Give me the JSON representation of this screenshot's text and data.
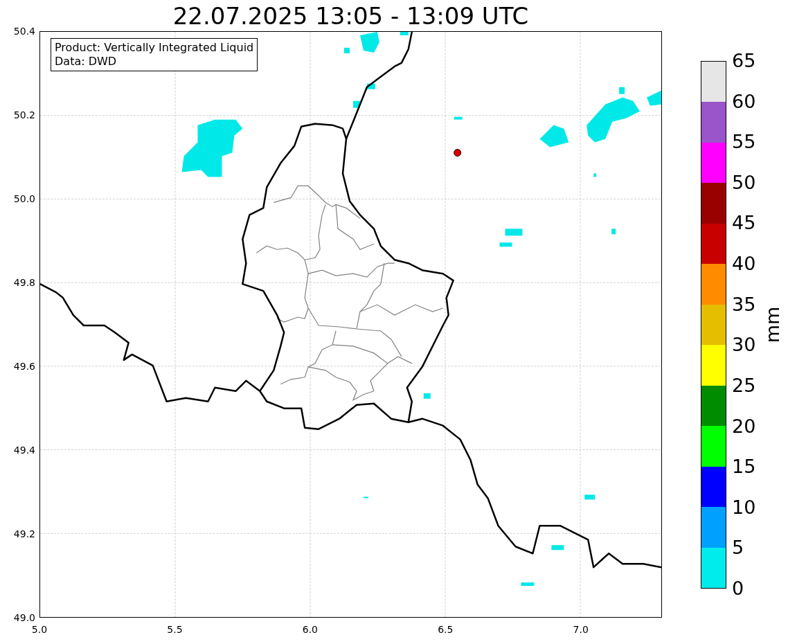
{
  "title": "22.07.2025 13:05 - 13:09 UTC",
  "legend": [
    "Product: Vertically Integrated Liquid",
    "Data: DWD"
  ],
  "y_ticks": [
    "50.4",
    "50.2",
    "50.0",
    "49.8",
    "49.6",
    "49.4",
    "49.2",
    "49.0"
  ],
  "x_ticks": [
    "5.0",
    "5.5",
    "6.0",
    "6.5",
    "7.0"
  ],
  "colorbar": {
    "label": "mm",
    "ticks": [
      "65",
      "60",
      "55",
      "50",
      "45",
      "40",
      "35",
      "30",
      "25",
      "20",
      "15",
      "10",
      "5",
      "0"
    ],
    "segments": [
      {
        "color": "#e6e6e6"
      },
      {
        "color": "#9955c9"
      },
      {
        "color": "#ff00ff"
      },
      {
        "color": "#990000"
      },
      {
        "color": "#c80000"
      },
      {
        "color": "#ff8c00"
      },
      {
        "color": "#e6be00"
      },
      {
        "color": "#ffff00"
      },
      {
        "color": "#008c00"
      },
      {
        "color": "#00ff00"
      },
      {
        "color": "#0000ff"
      },
      {
        "color": "#00a0ff"
      },
      {
        "color": "#00ecec"
      }
    ]
  }
}
